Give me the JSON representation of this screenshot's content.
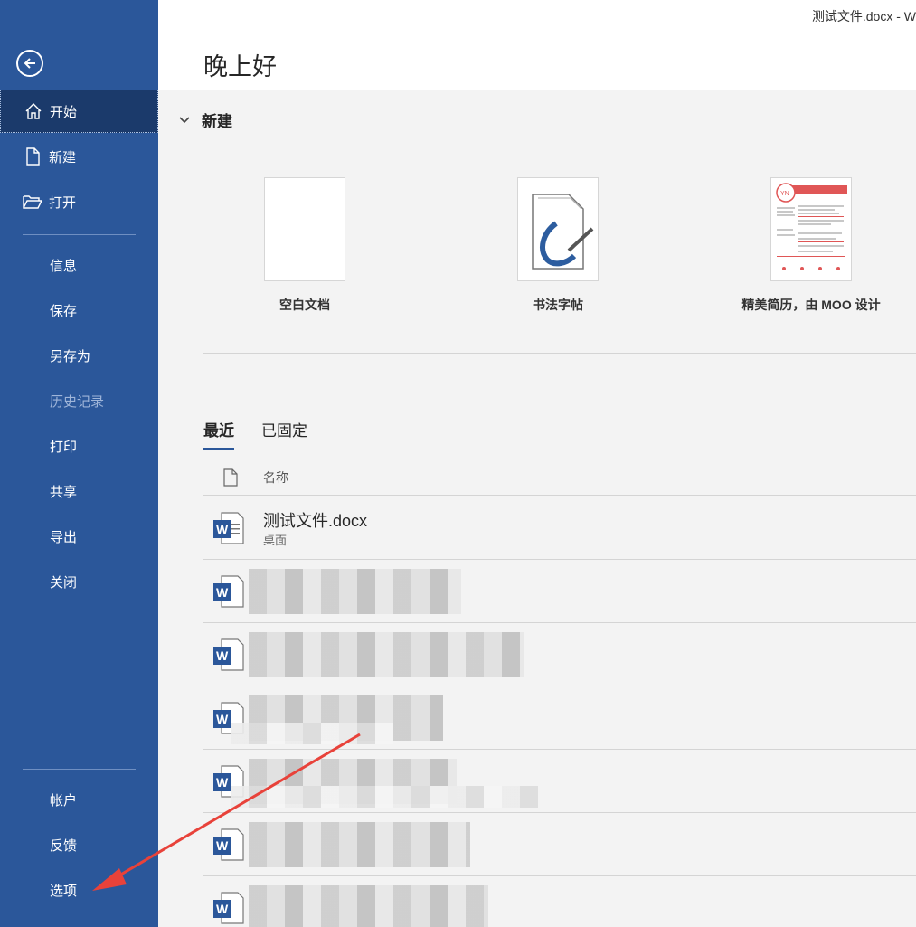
{
  "window": {
    "title": "测试文件.docx  -  W"
  },
  "sidebar": {
    "top_items": [
      {
        "label": "开始",
        "icon": "home-icon"
      },
      {
        "label": "新建",
        "icon": "new-document-icon"
      },
      {
        "label": "打开",
        "icon": "open-folder-icon"
      }
    ],
    "mid_items": [
      {
        "label": "信息"
      },
      {
        "label": "保存"
      },
      {
        "label": "另存为"
      },
      {
        "label": "历史记录"
      },
      {
        "label": "打印"
      },
      {
        "label": "共享"
      },
      {
        "label": "导出"
      },
      {
        "label": "关闭"
      }
    ],
    "bottom_items": [
      {
        "label": "帐户"
      },
      {
        "label": "反馈"
      },
      {
        "label": "选项"
      }
    ]
  },
  "main": {
    "greeting": "晚上好",
    "new_section": {
      "title": "新建"
    },
    "templates": [
      {
        "label": "空白文档"
      },
      {
        "label": "书法字帖"
      },
      {
        "label": "精美简历，由 MOO 设计"
      }
    ],
    "tabs": [
      {
        "label": "最近"
      },
      {
        "label": "已固定"
      }
    ],
    "list_header": {
      "name": "名称"
    },
    "files": [
      {
        "name": "测试文件.docx",
        "location": "桌面"
      }
    ]
  },
  "colors": {
    "sidebar": "#2b579a",
    "sidebar_active": "#1b3a6b",
    "word_blue": "#2b579a",
    "arrow": "#e8423a"
  }
}
